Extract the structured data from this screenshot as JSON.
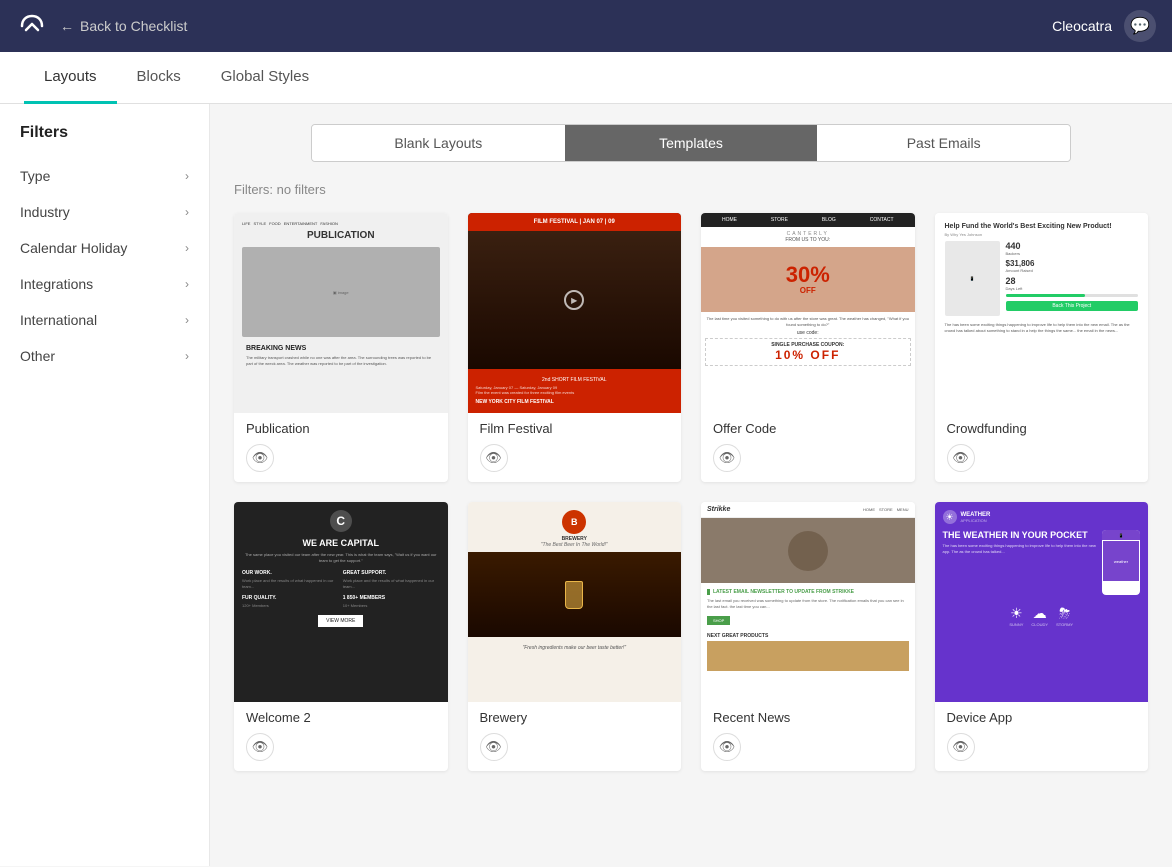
{
  "topNav": {
    "backLabel": "Back to Checklist",
    "username": "Cleocatra"
  },
  "tabs": [
    {
      "id": "layouts",
      "label": "Layouts",
      "active": true
    },
    {
      "id": "blocks",
      "label": "Blocks",
      "active": false
    },
    {
      "id": "global-styles",
      "label": "Global Styles",
      "active": false
    }
  ],
  "layoutToggle": [
    {
      "id": "blank-layouts",
      "label": "Blank Layouts",
      "active": false
    },
    {
      "id": "templates",
      "label": "Templates",
      "active": true
    },
    {
      "id": "past-emails",
      "label": "Past Emails",
      "active": false
    }
  ],
  "filtersLabel": "Filters: no filters",
  "sidebar": {
    "title": "Filters",
    "items": [
      {
        "id": "type",
        "label": "Type"
      },
      {
        "id": "industry",
        "label": "Industry"
      },
      {
        "id": "calendar-holiday",
        "label": "Calendar Holiday"
      },
      {
        "id": "integrations",
        "label": "Integrations"
      },
      {
        "id": "international",
        "label": "International"
      },
      {
        "id": "other",
        "label": "Other"
      }
    ]
  },
  "templates": [
    {
      "id": "publication",
      "label": "Publication"
    },
    {
      "id": "film-festival",
      "label": "Film Festival"
    },
    {
      "id": "offer-code",
      "label": "Offer Code"
    },
    {
      "id": "crowdfunding",
      "label": "Crowdfunding"
    },
    {
      "id": "welcome-2",
      "label": "Welcome 2"
    },
    {
      "id": "brewery",
      "label": "Brewery"
    },
    {
      "id": "recent-news",
      "label": "Recent News"
    },
    {
      "id": "device-app",
      "label": "Device App"
    }
  ],
  "icons": {
    "back": "←",
    "chevron": "›",
    "eye": "👁",
    "chat": "💬"
  }
}
